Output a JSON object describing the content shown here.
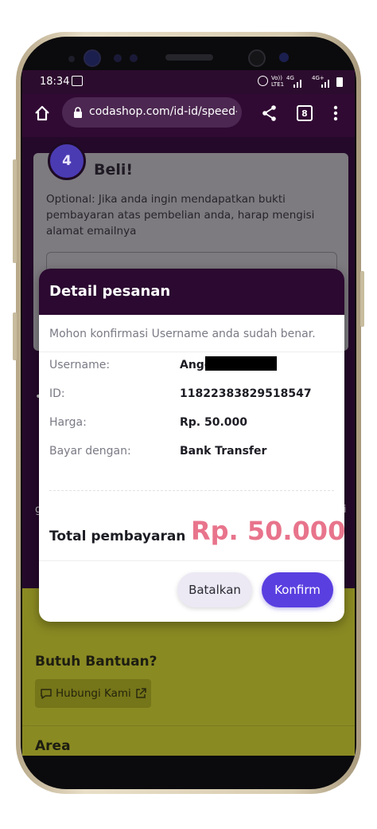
{
  "status_bar": {
    "time": "18:34",
    "network_label": "Vo)) LTE1",
    "signal_1": "4G",
    "signal_2": "4G+"
  },
  "browser": {
    "url": "codashop.com/id-id/speed-c",
    "tab_count": "8"
  },
  "page": {
    "step_number": "4",
    "step_title": "Beli!",
    "email_note": "Optional: Jika anda ingin mendapatkan bukti pembayaran atas pembelian anda, harap mengisi alamat emailnya",
    "help_title": "Butuh Bantuan?",
    "contact_label": "Hubungi Kami",
    "area_title": "Area"
  },
  "modal": {
    "title": "Detail pesanan",
    "instruction": "Mohon konfirmasi Username anda sudah benar.",
    "rows": [
      {
        "label": "Username:",
        "value": "Angg"
      },
      {
        "label": "ID:",
        "value": "11822383829518547"
      },
      {
        "label": "Harga:",
        "value": "Rp. 50.000"
      },
      {
        "label": "Bayar dengan:",
        "value": "Bank Transfer"
      }
    ],
    "total_label": "Total pembayaran",
    "total_value": "Rp. 50.000",
    "cancel_label": "Batalkan",
    "confirm_label": "Konfirm"
  },
  "colors": {
    "brand_purple": "#2b0930",
    "confirm_button": "#5a3fe0",
    "total_amount": "#e8748c",
    "help_background": "#8a8a23"
  }
}
